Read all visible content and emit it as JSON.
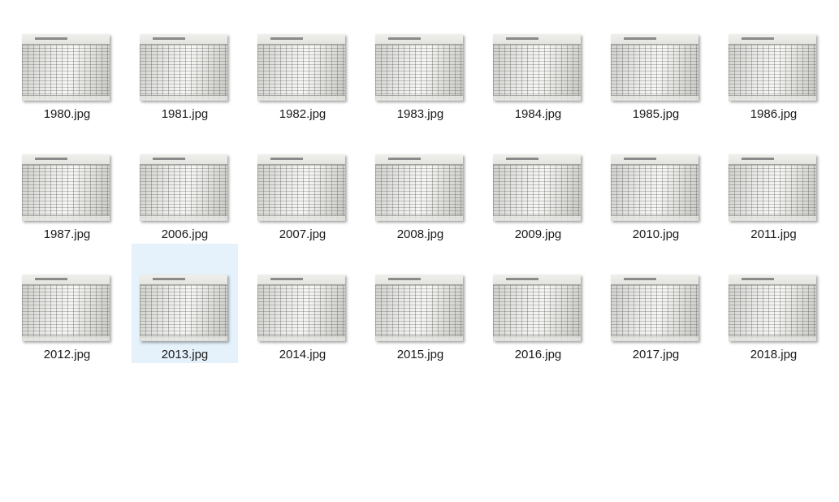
{
  "files": [
    {
      "name": "1980.jpg",
      "selected": false
    },
    {
      "name": "1981.jpg",
      "selected": false
    },
    {
      "name": "1982.jpg",
      "selected": false
    },
    {
      "name": "1983.jpg",
      "selected": false
    },
    {
      "name": "1984.jpg",
      "selected": false
    },
    {
      "name": "1985.jpg",
      "selected": false
    },
    {
      "name": "1986.jpg",
      "selected": false
    },
    {
      "name": "1987.jpg",
      "selected": false
    },
    {
      "name": "2006.jpg",
      "selected": false
    },
    {
      "name": "2007.jpg",
      "selected": false
    },
    {
      "name": "2008.jpg",
      "selected": false
    },
    {
      "name": "2009.jpg",
      "selected": false
    },
    {
      "name": "2010.jpg",
      "selected": false
    },
    {
      "name": "2011.jpg",
      "selected": false
    },
    {
      "name": "2012.jpg",
      "selected": false
    },
    {
      "name": "2013.jpg",
      "selected": true
    },
    {
      "name": "2014.jpg",
      "selected": false
    },
    {
      "name": "2015.jpg",
      "selected": false
    },
    {
      "name": "2016.jpg",
      "selected": false
    },
    {
      "name": "2017.jpg",
      "selected": false
    },
    {
      "name": "2018.jpg",
      "selected": false
    }
  ],
  "colors": {
    "selection": "#e5f1fb",
    "text": "#1a1a1a",
    "background": "#ffffff"
  }
}
